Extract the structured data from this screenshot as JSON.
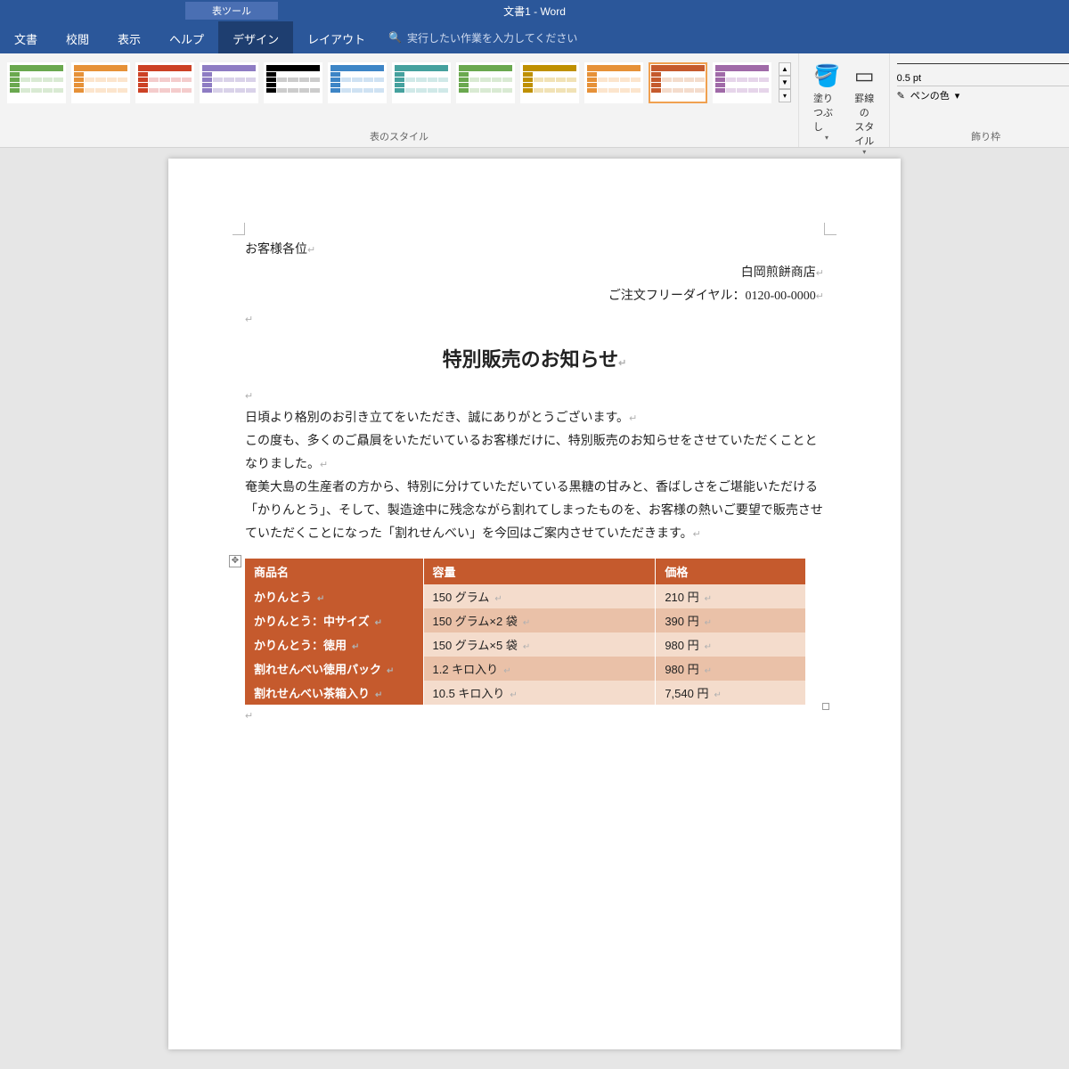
{
  "app": {
    "context_tab_label": "表ツール",
    "title": "文書1 - Word"
  },
  "tabs": {
    "items": [
      "文書",
      "校閲",
      "表示",
      "ヘルプ",
      "デザイン",
      "レイアウト"
    ],
    "active_index": 4,
    "search_placeholder": "実行したい作業を入力してください"
  },
  "ribbon": {
    "styles_group_label": "表のスタイル",
    "shading_label": "塗りつぶし",
    "border_styles_label": "罫線の\nスタイル",
    "borders_group_label": "飾り枠",
    "pen_weight": "0.5 pt",
    "pen_color_label": "ペンの色",
    "style_variants": [
      {
        "header": "#6aa84f",
        "body": "#d9ead3"
      },
      {
        "header": "#e69138",
        "body": "#fce5cd"
      },
      {
        "header": "#cc4125",
        "body": "#f4cccc"
      },
      {
        "header": "#8e7cc3",
        "body": "#d9d2e9"
      },
      {
        "header": "#000000",
        "body": "#cccccc"
      },
      {
        "header": "#3d85c6",
        "body": "#cfe2f3"
      },
      {
        "header": "#45a19e",
        "body": "#d0e9e8"
      },
      {
        "header": "#6aa84f",
        "body": "#d9ead3"
      },
      {
        "header": "#bf9000",
        "body": "#f1e2b6"
      },
      {
        "header": "#e69138",
        "body": "#fce5cd"
      },
      {
        "header": "#c55a2d",
        "body": "#f4dccc"
      },
      {
        "header": "#a06aa8",
        "body": "#e6d5ea"
      }
    ],
    "selected_style_index": 10
  },
  "document": {
    "salutation": "お客様各位",
    "company": "白岡煎餅商店",
    "phone_line": "ご注文フリーダイヤル：0120-00-0000",
    "heading": "特別販売のお知らせ",
    "para1": "日頃より格別のお引き立てをいただき、誠にありがとうございます。",
    "para2": "この度も、多くのご贔屓をいただいているお客様だけに、特別販売のお知らせをさせていただくこととなりました。",
    "para3": "奄美大島の生産者の方から、特別に分けていただいている黒糖の甘みと、香ばしさをご堪能いただける「かりんとう」、そして、製造途中に残念ながら割れてしまったものを、お客様の熱いご要望で販売させていただくことになった「割れせんべい」を今回はご案内させていただきます。",
    "table": {
      "headers": [
        "商品名",
        "容量",
        "価格"
      ],
      "rows": [
        {
          "name": "かりんとう",
          "vol": "150 グラム",
          "price": "210 円"
        },
        {
          "name": "かりんとう：中サイズ",
          "vol": "150 グラム×2 袋",
          "price": "390 円"
        },
        {
          "name": "かりんとう：徳用",
          "vol": "150 グラム×5 袋",
          "price": "980 円"
        },
        {
          "name": "割れせんべい徳用パック",
          "vol": "1.2 キロ入り",
          "price": "980 円"
        },
        {
          "name": "割れせんべい茶箱入り",
          "vol": "10.5 キロ入り",
          "price": "7,540 円"
        }
      ]
    }
  }
}
